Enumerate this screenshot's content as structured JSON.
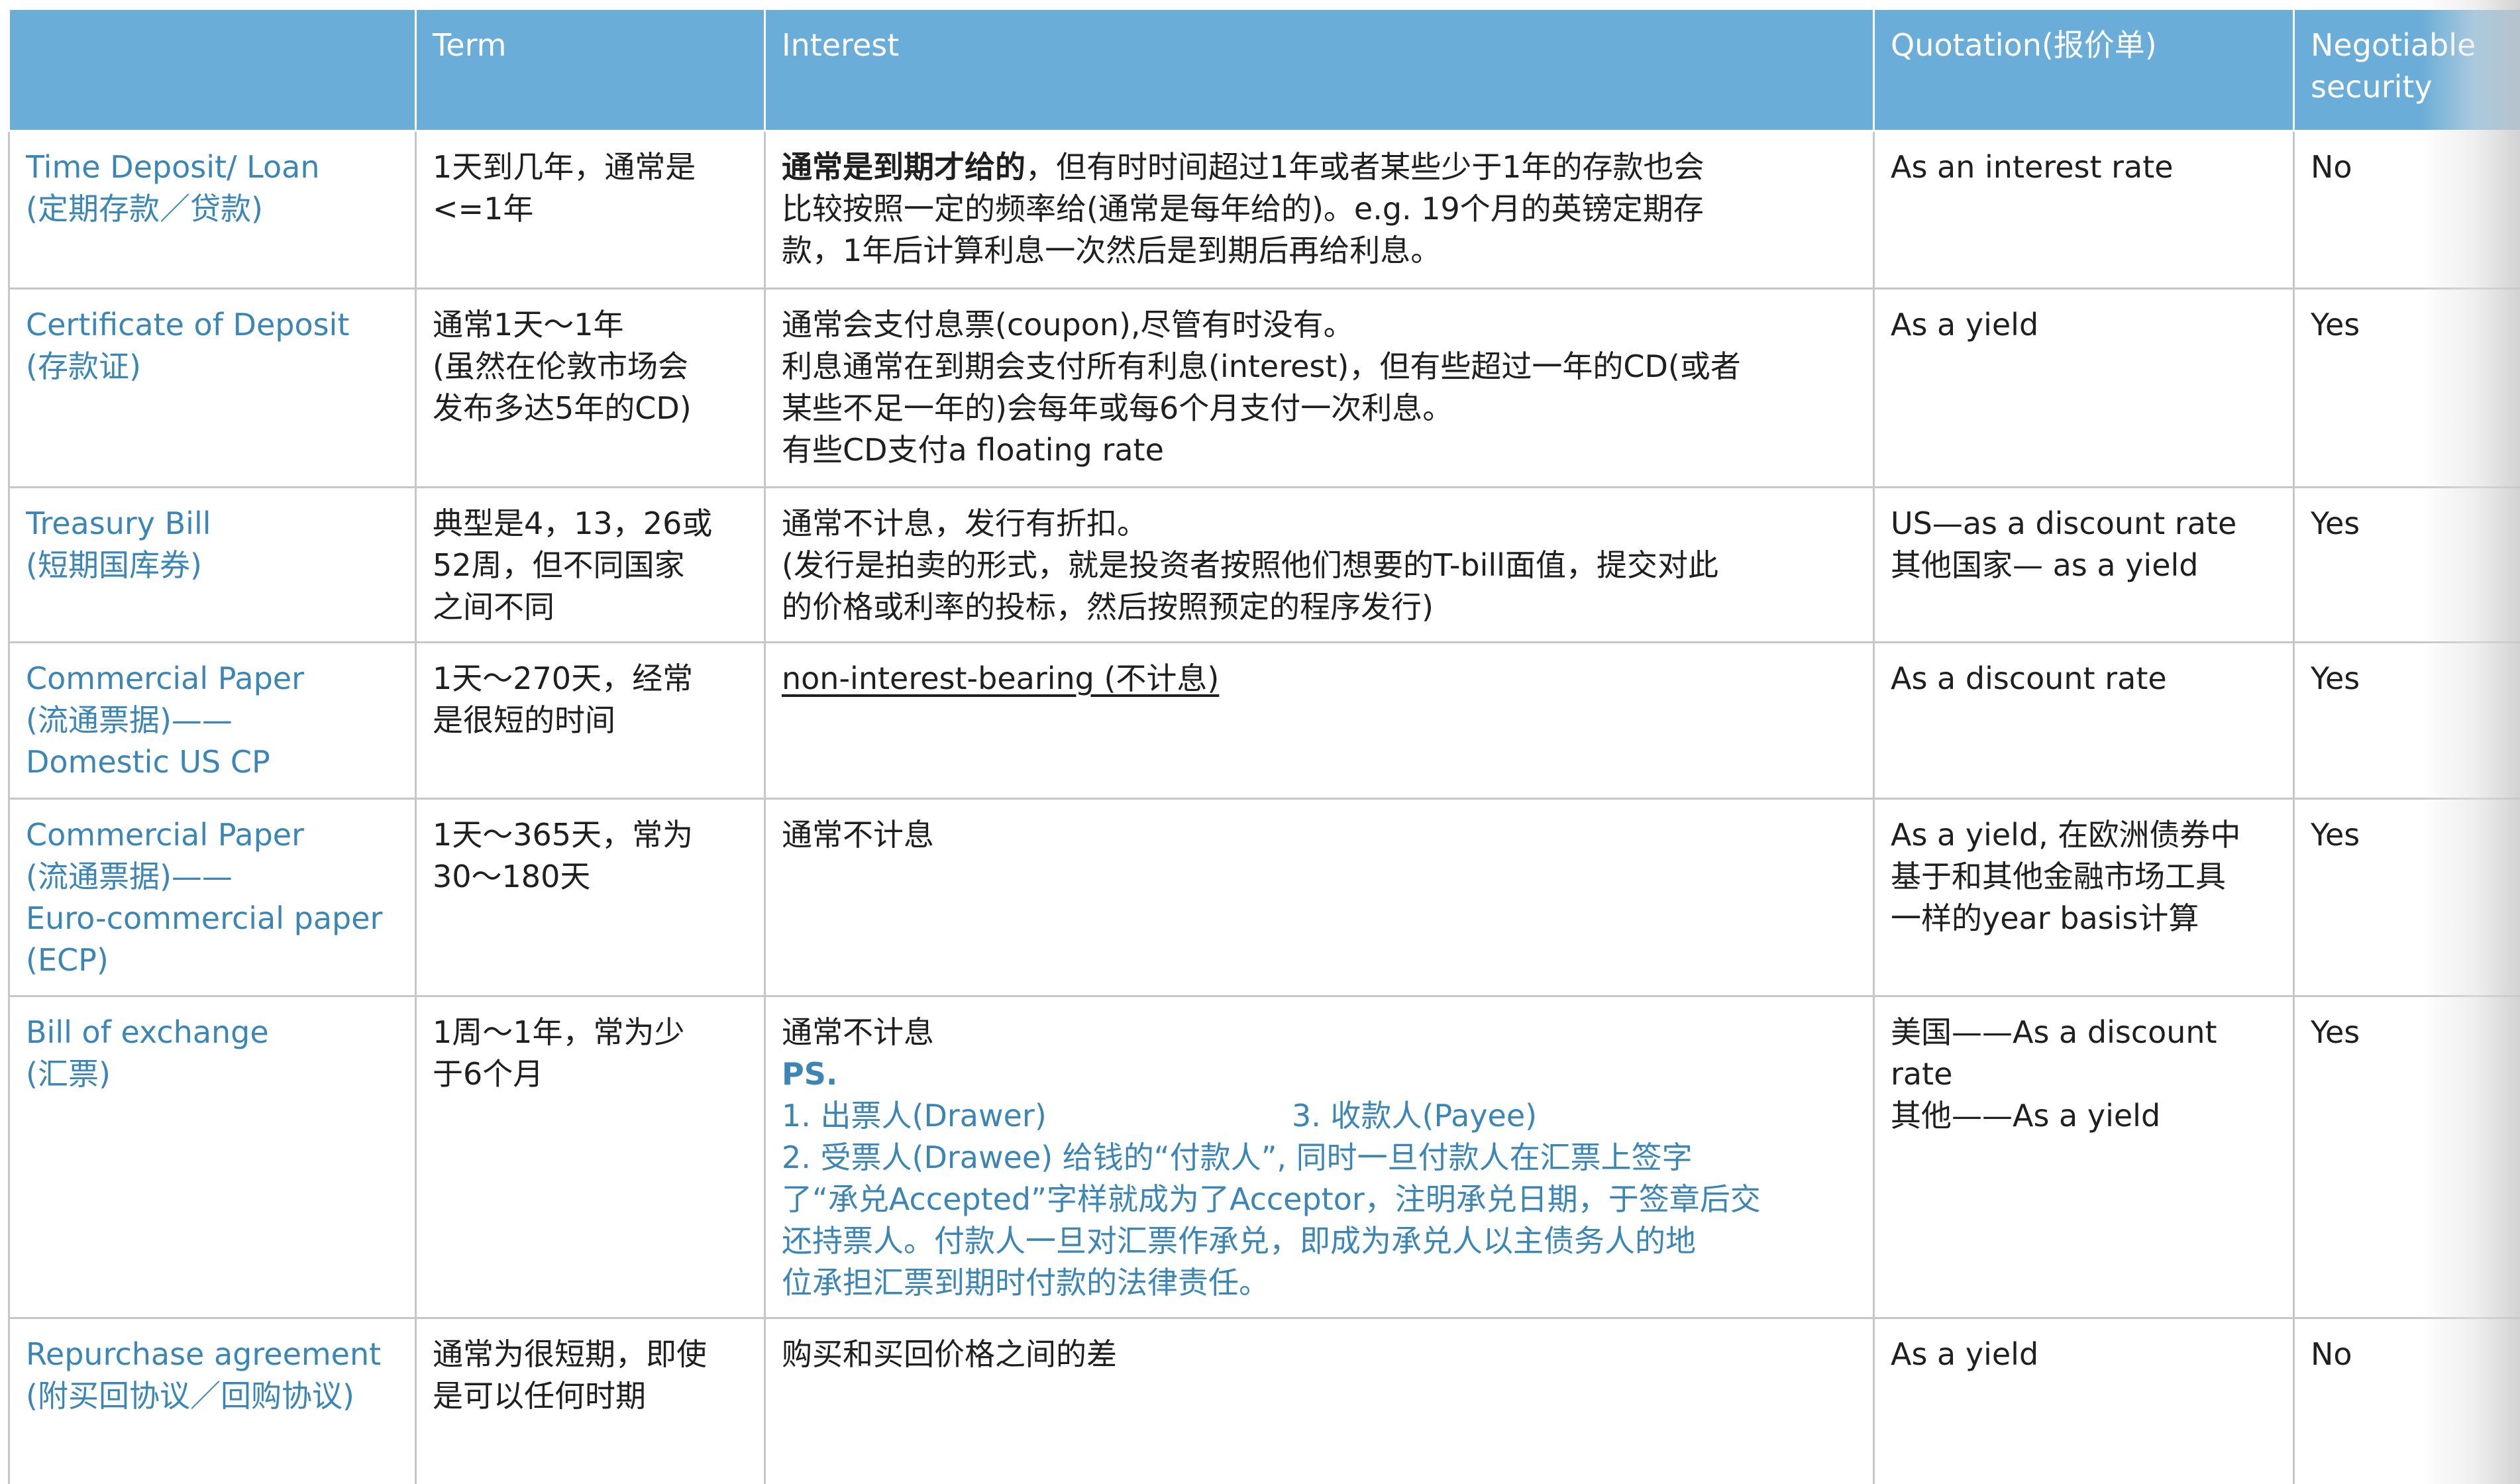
{
  "header": {
    "col0": "",
    "col1": "Term",
    "col2": "Interest",
    "col3": "Quotation(报价单)",
    "col4_line1": "Negotiable",
    "col4_line2": "security"
  },
  "rows": [
    {
      "name_lines": [
        "Time Deposit/ Loan",
        "(定期存款／贷款)"
      ],
      "term_lines": [
        "1天到几年，通常是",
        "<=1年"
      ],
      "interest": {
        "bold_prefix": "通常是到期才给的",
        "first_line_rest": "，但有时时间超过1年或者某些少于1年的存款也会",
        "lines": [
          "比较按照一定的频率给(通常是每年给的)。e.g. 19个月的英镑定期存",
          "款，1年后计算利息一次然后是到期后再给利息。"
        ]
      },
      "quote_lines": [
        "As an interest rate"
      ],
      "negotiable": "No"
    },
    {
      "name_lines": [
        "Certificate of Deposit",
        "(存款证)"
      ],
      "term_lines": [
        "通常1天～1年",
        "(虽然在伦敦市场会",
        "发布多达5年的CD)"
      ],
      "interest_lines": [
        "通常会支付息票(coupon),尽管有时没有。",
        "利息通常在到期会支付所有利息(interest)，但有些超过一年的CD(或者",
        "某些不足一年的)会每年或每6个月支付一次利息。",
        "有些CD支付a floating rate"
      ],
      "quote_lines": [
        "As a yield"
      ],
      "negotiable": "Yes"
    },
    {
      "name_lines": [
        "Treasury Bill",
        "(短期国库券)"
      ],
      "term_lines": [
        "典型是4，13，26或",
        "52周，但不同国家",
        "之间不同"
      ],
      "interest_lines": [
        "通常不计息，发行有折扣。",
        "(发行是拍卖的形式，就是投资者按照他们想要的T-bill面值，提交对此",
        "的价格或利率的投标，然后按照预定的程序发行)"
      ],
      "quote_lines": [
        "US—as a discount rate",
        "其他国家— as a yield"
      ],
      "negotiable": "Yes"
    },
    {
      "name_lines": [
        "Commercial Paper",
        "(流通票据)——",
        "Domestic US CP"
      ],
      "term_lines": [
        "1天～270天，经常",
        "是很短的时间"
      ],
      "interest_underlined": "non-interest-bearing (不计息)",
      "quote_lines": [
        "As a discount rate"
      ],
      "negotiable": "Yes"
    },
    {
      "name_lines": [
        "Commercial Paper",
        "(流通票据)——",
        "Euro-commercial paper",
        "(ECP)"
      ],
      "term_lines": [
        "1天～365天，常为",
        "30～180天"
      ],
      "interest_lines": [
        "通常不计息"
      ],
      "quote_lines": [
        "As a yield, 在欧洲债券中",
        "基于和其他金融市场工具",
        "一样的year basis计算"
      ],
      "negotiable": "Yes"
    },
    {
      "name_lines": [
        "Bill of exchange",
        "(汇票)"
      ],
      "term_lines": [
        "1周～1年，常为少",
        "于6个月"
      ],
      "interest": {
        "first": "通常不计息",
        "ps": "PS.",
        "item1": "1. 出票人(Drawer)",
        "item3": "3. 收款人(Payee)",
        "blue_lines": [
          "2. 受票人(Drawee) 给钱的“付款人”, 同时一旦付款人在汇票上签字",
          "了“承兑Accepted”字样就成为了Acceptor，注明承兑日期，于签章后交",
          "还持票人。付款人一旦对汇票作承兑，即成为承兑人以主债务人的地",
          "位承担汇票到期时付款的法律责任。"
        ]
      },
      "quote_lines": [
        "美国——As a discount",
        "rate",
        "其他——As a yield"
      ],
      "negotiable": "Yes"
    },
    {
      "name_lines": [
        "Repurchase agreement",
        "(附买回协议／回购协议)"
      ],
      "term_lines": [
        "通常为很短期，即使",
        "是可以任何时期"
      ],
      "interest_lines": [
        "购买和买回价格之间的差"
      ],
      "quote_lines": [
        "As a yield"
      ],
      "negotiable": "No"
    }
  ]
}
